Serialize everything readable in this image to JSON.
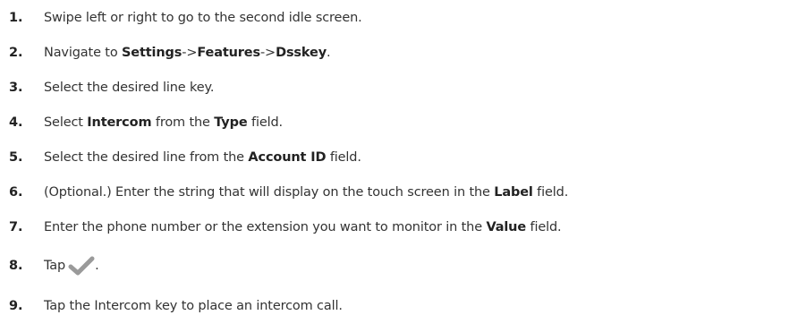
{
  "steps": [
    {
      "number": "1.",
      "parts": [
        {
          "t": "Swipe left or right to go to the second idle screen."
        }
      ]
    },
    {
      "number": "2.",
      "parts": [
        {
          "t": "Navigate to "
        },
        {
          "t": "Settings",
          "b": true
        },
        {
          "t": "->"
        },
        {
          "t": "Features",
          "b": true
        },
        {
          "t": "->"
        },
        {
          "t": "Dsskey",
          "b": true
        },
        {
          "t": "."
        }
      ]
    },
    {
      "number": "3.",
      "parts": [
        {
          "t": "Select the desired line key."
        }
      ]
    },
    {
      "number": "4.",
      "parts": [
        {
          "t": "Select "
        },
        {
          "t": "Intercom",
          "b": true
        },
        {
          "t": " from the "
        },
        {
          "t": "Type",
          "b": true
        },
        {
          "t": " field."
        }
      ]
    },
    {
      "number": "5.",
      "parts": [
        {
          "t": "Select the desired line from the "
        },
        {
          "t": "Account ID",
          "b": true
        },
        {
          "t": " field."
        }
      ]
    },
    {
      "number": "6.",
      "parts": [
        {
          "t": "(Optional.) Enter the string that will display on the touch screen in the "
        },
        {
          "t": "Label",
          "b": true
        },
        {
          "t": " field."
        }
      ]
    },
    {
      "number": "7.",
      "parts": [
        {
          "t": "Enter the phone number or the extension you want to monitor in the "
        },
        {
          "t": "Value",
          "b": true
        },
        {
          "t": " field."
        }
      ]
    },
    {
      "number": "8.",
      "parts": [
        {
          "t": "Tap"
        },
        {
          "icon": "checkmark-icon"
        },
        {
          "t": "."
        }
      ]
    },
    {
      "number": "9.",
      "parts": [
        {
          "t": "Tap the Intercom key to place an intercom call."
        }
      ]
    }
  ],
  "colors": {
    "text": "#333333",
    "checkmark": "#9a9a9a"
  }
}
